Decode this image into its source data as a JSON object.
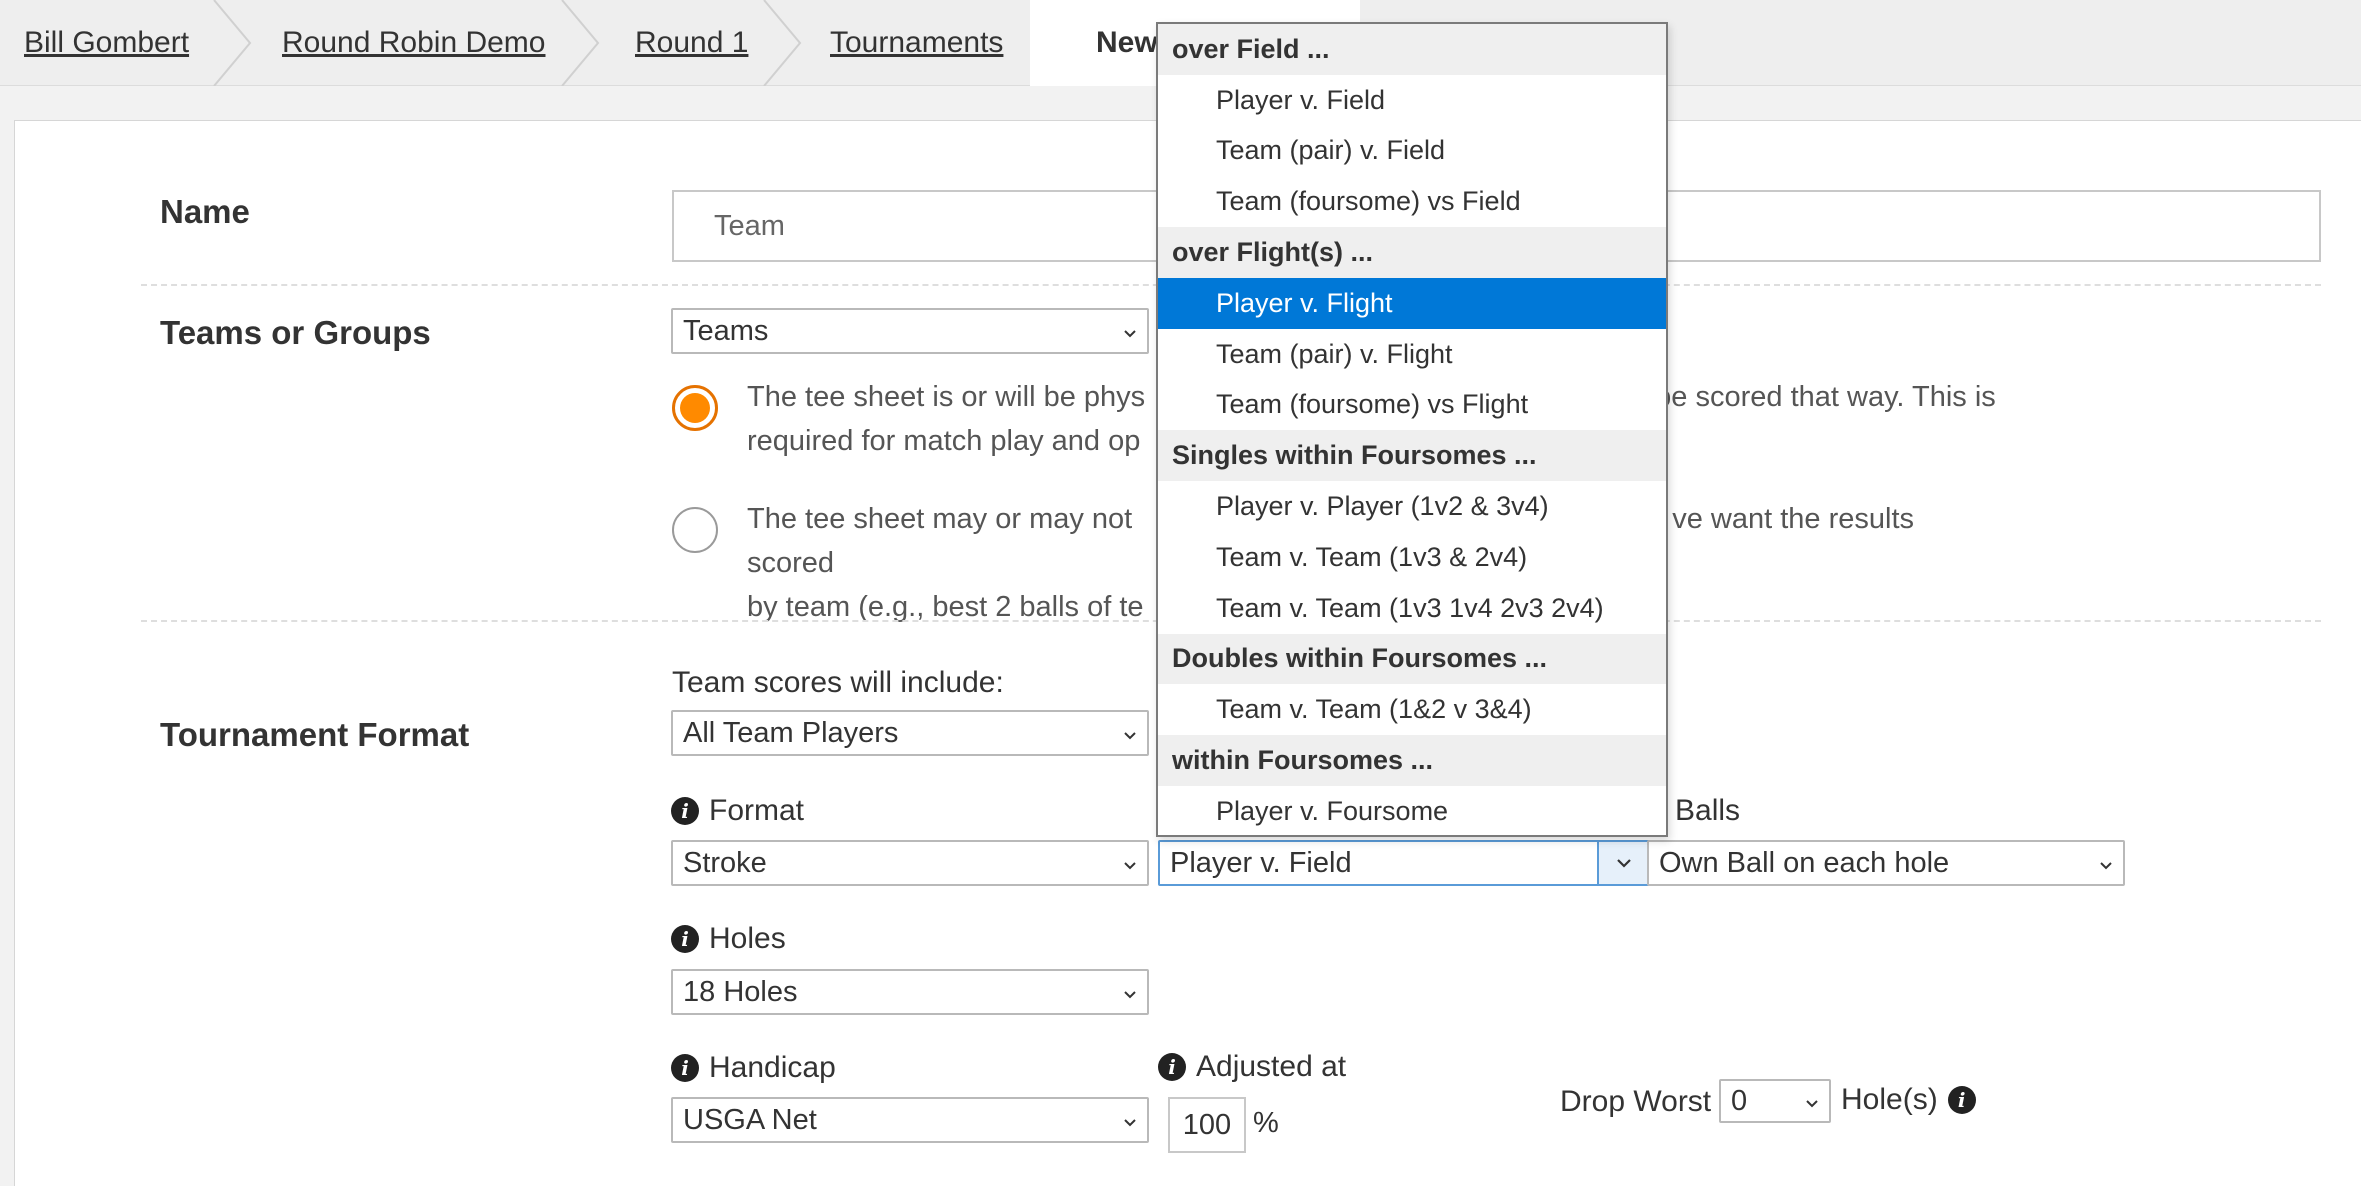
{
  "breadcrumb": {
    "items": [
      "Bill Gombert",
      "Round Robin Demo",
      "Round 1",
      "Tournaments"
    ],
    "current": "New"
  },
  "form": {
    "name": {
      "label": "Name",
      "value": "Team"
    },
    "teams_or_groups": {
      "label": "Teams or Groups",
      "selected": "Teams",
      "option_physical": "The tee sheet is or will be physically grouped by team, and we want the results scored that way. This is required for match play and optional for stroke play.",
      "option_physical_visible_line1": "The tee sheet is or will be phys",
      "option_physical_visible_line1b": "be scored that way. This is",
      "option_physical_visible_line2": "required for match play and op",
      "option_other_visible_line1": "The tee sheet may or may not",
      "option_other_visible_line1b": "ve want the results scored",
      "option_other_visible_line2": "by team (e.g., best 2 balls of te"
    },
    "tournament_format": {
      "label": "Tournament Format",
      "team_scores_label": "Team scores will include:",
      "team_scores_value": "All Team Players",
      "format_label": "Format",
      "format_value": "Stroke",
      "competition_value": "Player v. Field",
      "balls_label": "Balls",
      "balls_value": "Own Ball on each hole",
      "holes_label": "Holes",
      "holes_value": "18 Holes",
      "handicap_label": "Handicap",
      "handicap_value": "USGA Net",
      "adjusted_label": "Adjusted at",
      "adjusted_value": "100",
      "adjusted_unit": "%",
      "drop_worst_label": "Drop Worst",
      "drop_worst_value": "0",
      "holes_suffix": "Hole(s)"
    }
  },
  "dropdown": {
    "items": [
      {
        "type": "group",
        "label": "over Field ..."
      },
      {
        "type": "option",
        "label": "Player v. Field"
      },
      {
        "type": "option",
        "label": "Team (pair) v. Field"
      },
      {
        "type": "option",
        "label": "Team (foursome) vs Field"
      },
      {
        "type": "group",
        "label": "over Flight(s) ..."
      },
      {
        "type": "option",
        "label": "Player v. Flight",
        "selected": true
      },
      {
        "type": "option",
        "label": "Team (pair) v. Flight"
      },
      {
        "type": "option",
        "label": "Team (foursome) vs Flight"
      },
      {
        "type": "group",
        "label": "Singles within Foursomes ..."
      },
      {
        "type": "option",
        "label": "Player v. Player (1v2 & 3v4)"
      },
      {
        "type": "option",
        "label": "Team v. Team (1v3 & 2v4)"
      },
      {
        "type": "option",
        "label": "Team v. Team (1v3 1v4 2v3 2v4)"
      },
      {
        "type": "group",
        "label": "Doubles within Foursomes ..."
      },
      {
        "type": "option",
        "label": "Team v. Team (1&2 v 3&4)"
      },
      {
        "type": "group",
        "label": "within Foursomes ..."
      },
      {
        "type": "option",
        "label": "Player v. Foursome"
      }
    ]
  },
  "colors": {
    "accent_orange": "#ff8a00",
    "selection_blue": "#0078d7"
  }
}
